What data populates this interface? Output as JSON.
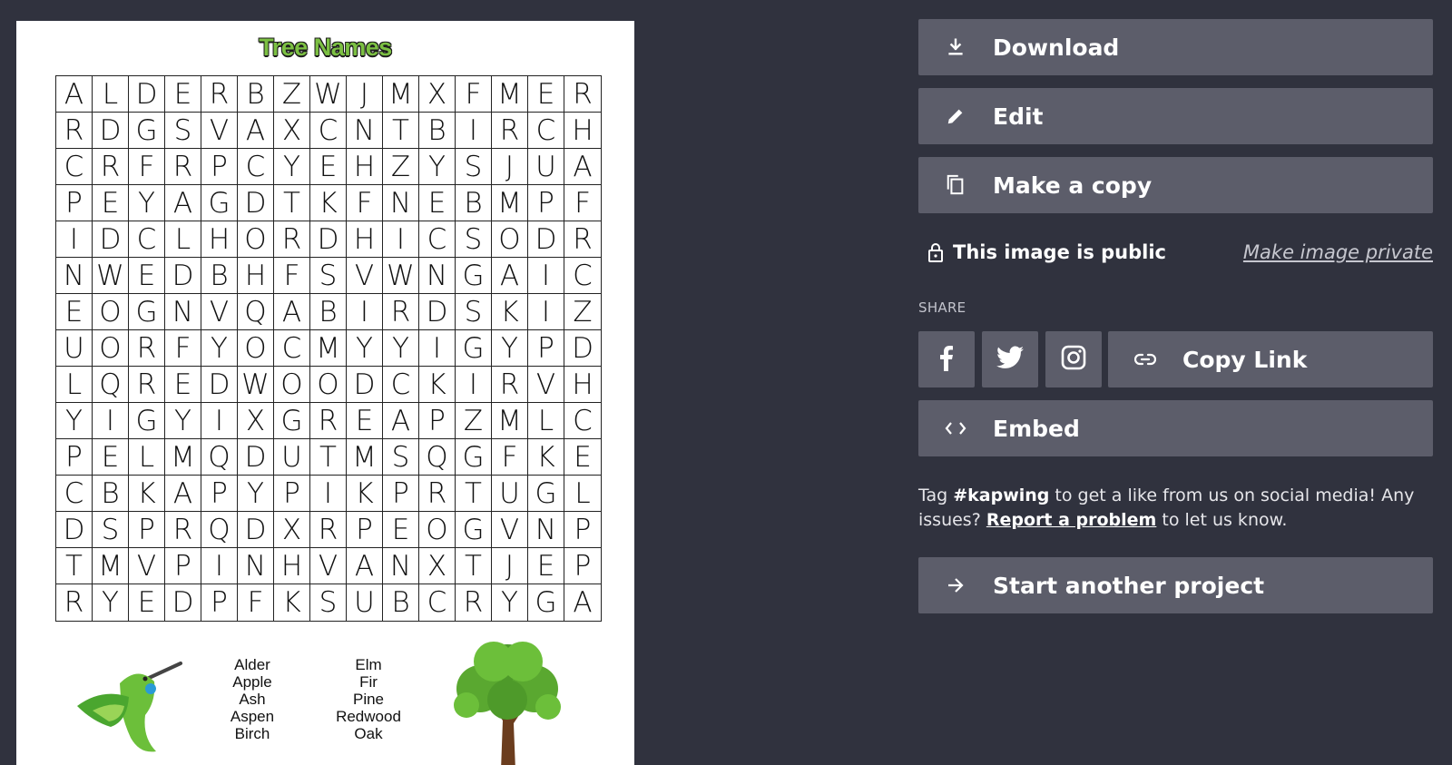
{
  "preview": {
    "title": "Tree Names",
    "grid_rows": [
      "ALDERBZWJMXFMER",
      "RDGSVAXCNTBIRCH",
      "CRFRPCYEHZYSJUA",
      "PEYAGDTKFNEBMPF",
      "IDCLHORDHICSODR",
      "NWEDBHFSVWNGAIC",
      "EOGNVQABIRDSKIZ",
      "UORFYOCMYYIGYPD",
      "LQREDWOODCKIRVH",
      "YIGYIXGREAPZMLC",
      "PELMQDUTMSQGFKE",
      "CBKAPYPIKPRTUGL",
      "DSPRQDXRPEOGVNP",
      "TMVPINHVANXTJEP",
      "RYEDPFKSUBCRYGA"
    ],
    "words_col1": [
      "Alder",
      "Apple",
      "Ash",
      "Aspen",
      "Birch"
    ],
    "words_col2": [
      "Elm",
      "Fir",
      "Pine",
      "Redwood",
      "Oak"
    ]
  },
  "actions": {
    "download": "Download",
    "edit": "Edit",
    "make_copy": "Make a copy",
    "embed": "Embed",
    "start_another": "Start another project"
  },
  "privacy": {
    "status": "This image is public",
    "toggle_link": "Make image private"
  },
  "share": {
    "label": "SHARE",
    "copy_link": "Copy Link"
  },
  "footer": {
    "tag_prefix": "Tag ",
    "hashtag": "#kapwing",
    "tag_middle": " to get a like from us on social media! Any issues? ",
    "report_link": "Report a problem",
    "tag_suffix": " to let us know."
  },
  "icons": [
    "download-icon",
    "pencil-icon",
    "copy-icon",
    "lock-icon",
    "facebook-icon",
    "twitter-icon",
    "instagram-icon",
    "link-icon",
    "code-icon",
    "arrow-right-icon"
  ],
  "colors": {
    "background": "#30323e",
    "button": "#5c5d6a",
    "title_green": "#7cc043"
  }
}
